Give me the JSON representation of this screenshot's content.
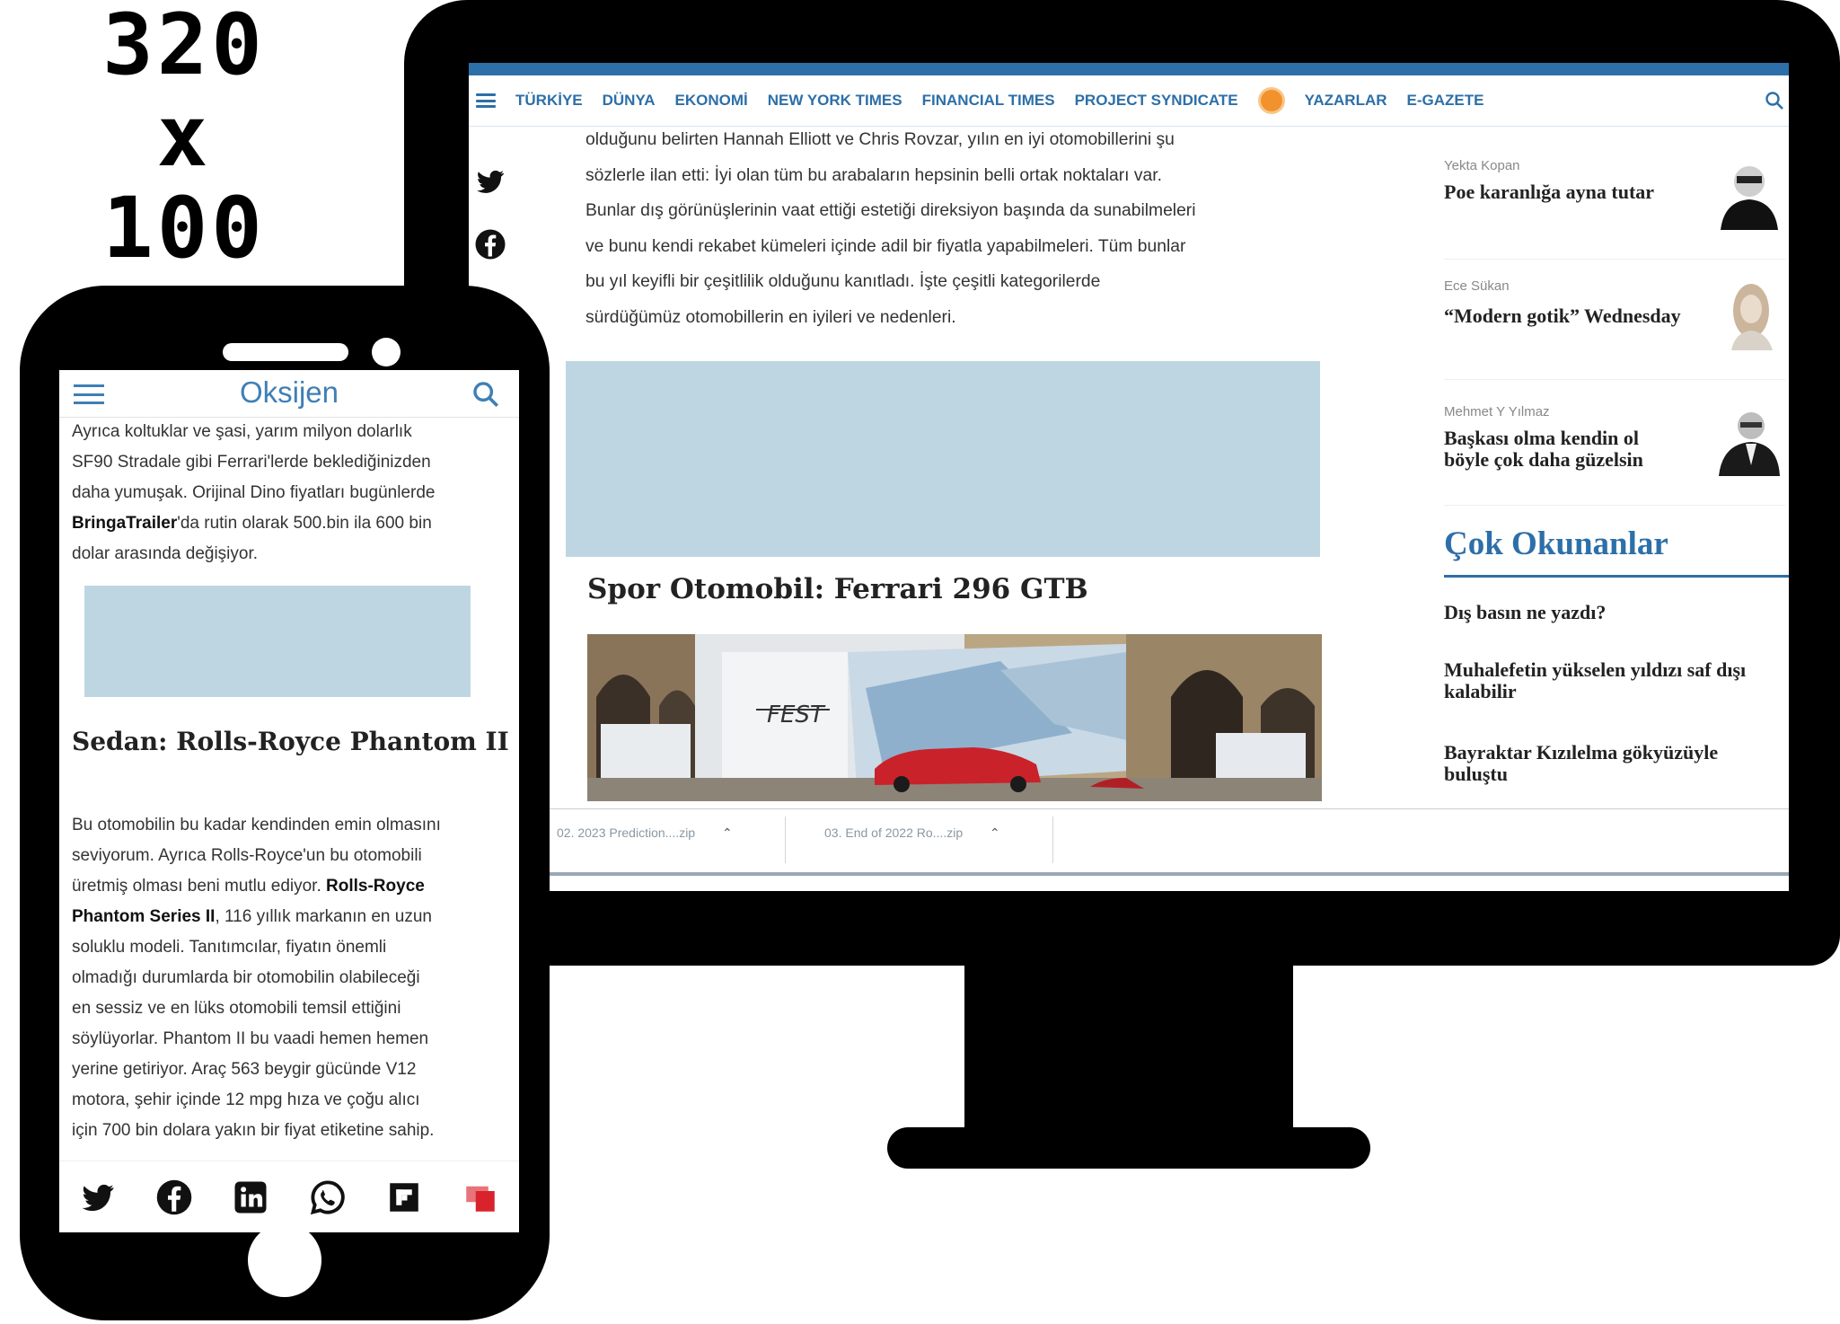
{
  "size_label": {
    "line1": "320",
    "line2": "x",
    "line3": "100"
  },
  "desktop": {
    "nav": {
      "items": [
        "TÜRKİYE",
        "DÜNYA",
        "EKONOMİ",
        "NEW YORK TIMES",
        "FINANCIAL TIMES",
        "PROJECT SYNDICATE",
        "YAZARLAR",
        "E-GAZETE"
      ]
    },
    "article": {
      "lines": [
        "olduğunu belirten Hannah Elliott ve Chris Rovzar, yılın en iyi otomobillerini şu",
        "sözlerle ilan etti: İyi olan tüm bu arabaların hepsinin belli ortak noktaları var.",
        "Bunlar dış görünüşlerinin vaat ettiği estetiği direksiyon başında da sunabilmeleri",
        "ve bunu kendi rekabet kümeleri içinde adil bir fiyatla yapabilmeleri. Tüm bunlar",
        "bu yıl keyifli bir çeşitlilik olduğunu kanıtladı. İşte çeşitli kategorilerde",
        "sürdüğümüz otomobillerin en iyileri ve nedenleri."
      ],
      "section_heading": "Spor Otomobil: Ferrari 296 GTB",
      "image_sign": "FEST"
    },
    "downloads": [
      {
        "label": "02. 2023 Prediction....zip"
      },
      {
        "label": "03. End of 2022 Ro....zip"
      }
    ],
    "sidebar": {
      "authors": [
        {
          "name": "Yekta Kopan",
          "title": "Poe karanlığa ayna tutar"
        },
        {
          "name": "Ece Sükan",
          "title": "“Modern gotik” Wednesday"
        },
        {
          "name": "Mehmet Y Yılmaz",
          "title": "Başkası olma kendin ol böyle çok daha güzelsin"
        }
      ],
      "most_read_title": "Çok Okunanlar",
      "most_read": [
        "Dış basın ne yazdı?",
        "Muhalefetin yükselen yıldızı saf dışı kalabilir",
        "Bayraktar Kızılelma gökyüzüyle buluştu"
      ]
    }
  },
  "mobile": {
    "logo": "Oksijen",
    "article_lines": [
      "Ayrıca koltuklar ve şasi, yarım milyon dolarlık",
      "SF90 Stradale gibi Ferrari'lerde beklediğinizden",
      "daha yumuşak. Orijinal Dino fiyatları bugünlerde",
      {
        "bold": "BringaTrailer",
        "rest": "'da rutin olarak 500.bin ila 600 bin"
      },
      "dolar arasında değişiyor."
    ],
    "heading": "Sedan: Rolls-Royce Phantom II",
    "body_lines": [
      "Bu otomobilin bu kadar kendinden emin olmasını",
      "seviyorum. Ayrıca Rolls-Royce'un bu otomobili",
      {
        "pre": "üretmiş olması beni mutlu ediyor. ",
        "bold": "Rolls-Royce"
      },
      {
        "bold": "Phantom Series II",
        "rest": ", 116 yıllık markanın en uzun"
      },
      "soluklu modeli. Tanıtımcılar, fiyatın önemli",
      "olmadığı durumlarda bir otomobilin olabileceği",
      "en sessiz ve en lüks otomobili temsil ettiğini",
      "söylüyorlar. Phantom II bu vaadi hemen hemen",
      "yerine getiriyor. Araç 563 beygir gücünde V12",
      "motora, şehir içinde 12 mpg hıza ve çoğu alıcı",
      "için 700 bin dolara yakın bir fiyat etiketine sahip."
    ],
    "share_icons": [
      "twitter-icon",
      "facebook-icon",
      "linkedin-icon",
      "whatsapp-icon",
      "flipboard-icon",
      "bookmark-icon"
    ]
  },
  "colors": {
    "accent": "#2d6fa8",
    "ad_placeholder": "#bed6e2",
    "logo_orange": "#f2922d"
  }
}
